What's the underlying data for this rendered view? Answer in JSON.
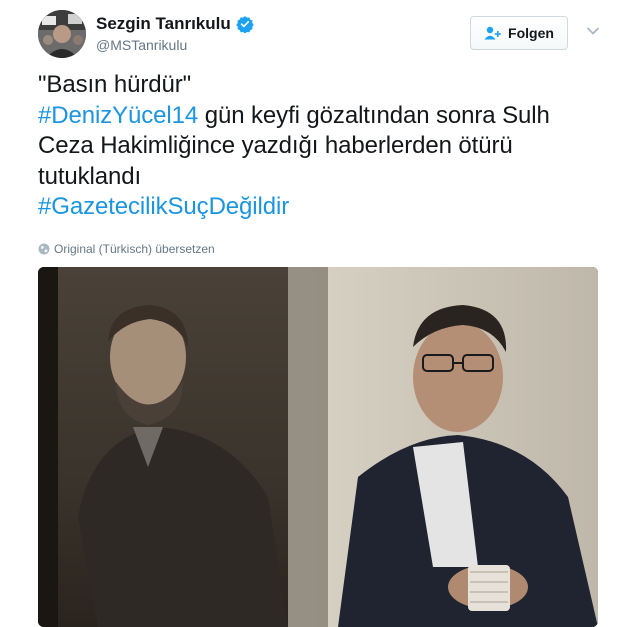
{
  "author": {
    "display_name": "Sezgin Tanrıkulu",
    "handle": "@MSTanrikulu",
    "verified": true,
    "avatar_icon": "avatar-photo-icon"
  },
  "follow_button": {
    "label": "Folgen",
    "icon": "person-plus-icon"
  },
  "menu_icon": "chevron-down-icon",
  "tweet": {
    "line1": "\"Basın hürdür\"",
    "hashtag1": "#DenizYücel14",
    "line2_rest": " gün keyfi gözaltından sonra Sulh Ceza Hakimliğince yazdığı haberlerden ötürü tutuklandı",
    "hashtag2": "#GazetecilikSuçDeğildir"
  },
  "translate_label": "Original (Türkisch) übersetzen",
  "colors": {
    "link": "#1b95e0",
    "verified": "#1da1f2",
    "secondary_text": "#657786",
    "primary_text": "#14171a"
  }
}
